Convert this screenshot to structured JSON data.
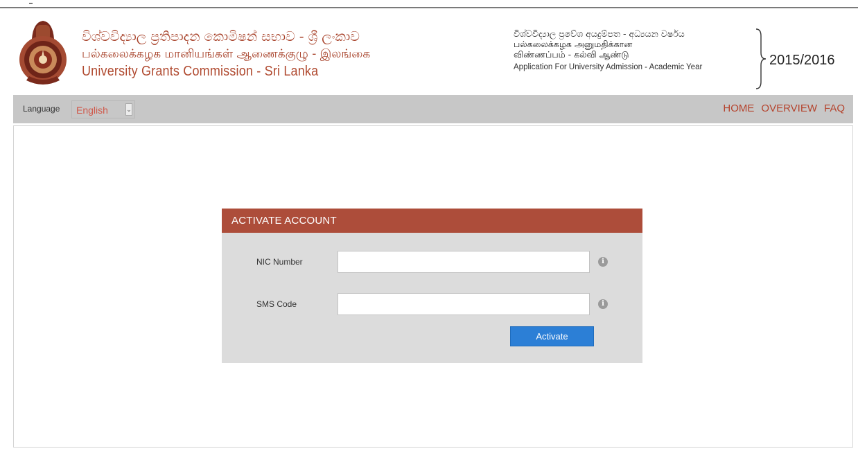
{
  "header": {
    "ugc_name_si": "විශ්වවිද්‍යාල ප්‍රතිපාදන කොමිෂන් සභාව - ශ්‍රී ලංකාව",
    "ugc_name_ta": "பல்கலைக்கழக மானியங்கள் ஆணைக்குழு - இலங்கை",
    "ugc_name_en": "University Grants Commission - Sri Lanka",
    "app_title_si": "විශ්වවිද්‍යාල ප්‍රවේශ අයදුම්පත - අධ්‍යයන වර්ෂය",
    "app_title_ta_1": "பல்கலைக்கழக அனுமதிக்கான",
    "app_title_ta_2": "விண்ணப்பம் - கல்வி ஆண்டு",
    "app_title_en": "Application For University Admission - Academic Year",
    "academic_year": "2015/2016"
  },
  "navbar": {
    "language_label": "Language",
    "language_selected": "English",
    "links": [
      "HOME",
      "OVERVIEW",
      "FAQ"
    ]
  },
  "activate_form": {
    "title": "ACTIVATE ACCOUNT",
    "nic_label": "NIC Number",
    "nic_value": "",
    "sms_label": "SMS Code",
    "sms_value": "",
    "submit_label": "Activate"
  },
  "colors": {
    "accent_red": "#ad4d3a",
    "button_blue": "#2c7fd6",
    "navbar_gray": "#c7c7c7",
    "panel_gray": "#dcdcdc"
  },
  "icons": [
    "ugc-emblem-logo",
    "info-icon",
    "chevron-down-icon"
  ]
}
